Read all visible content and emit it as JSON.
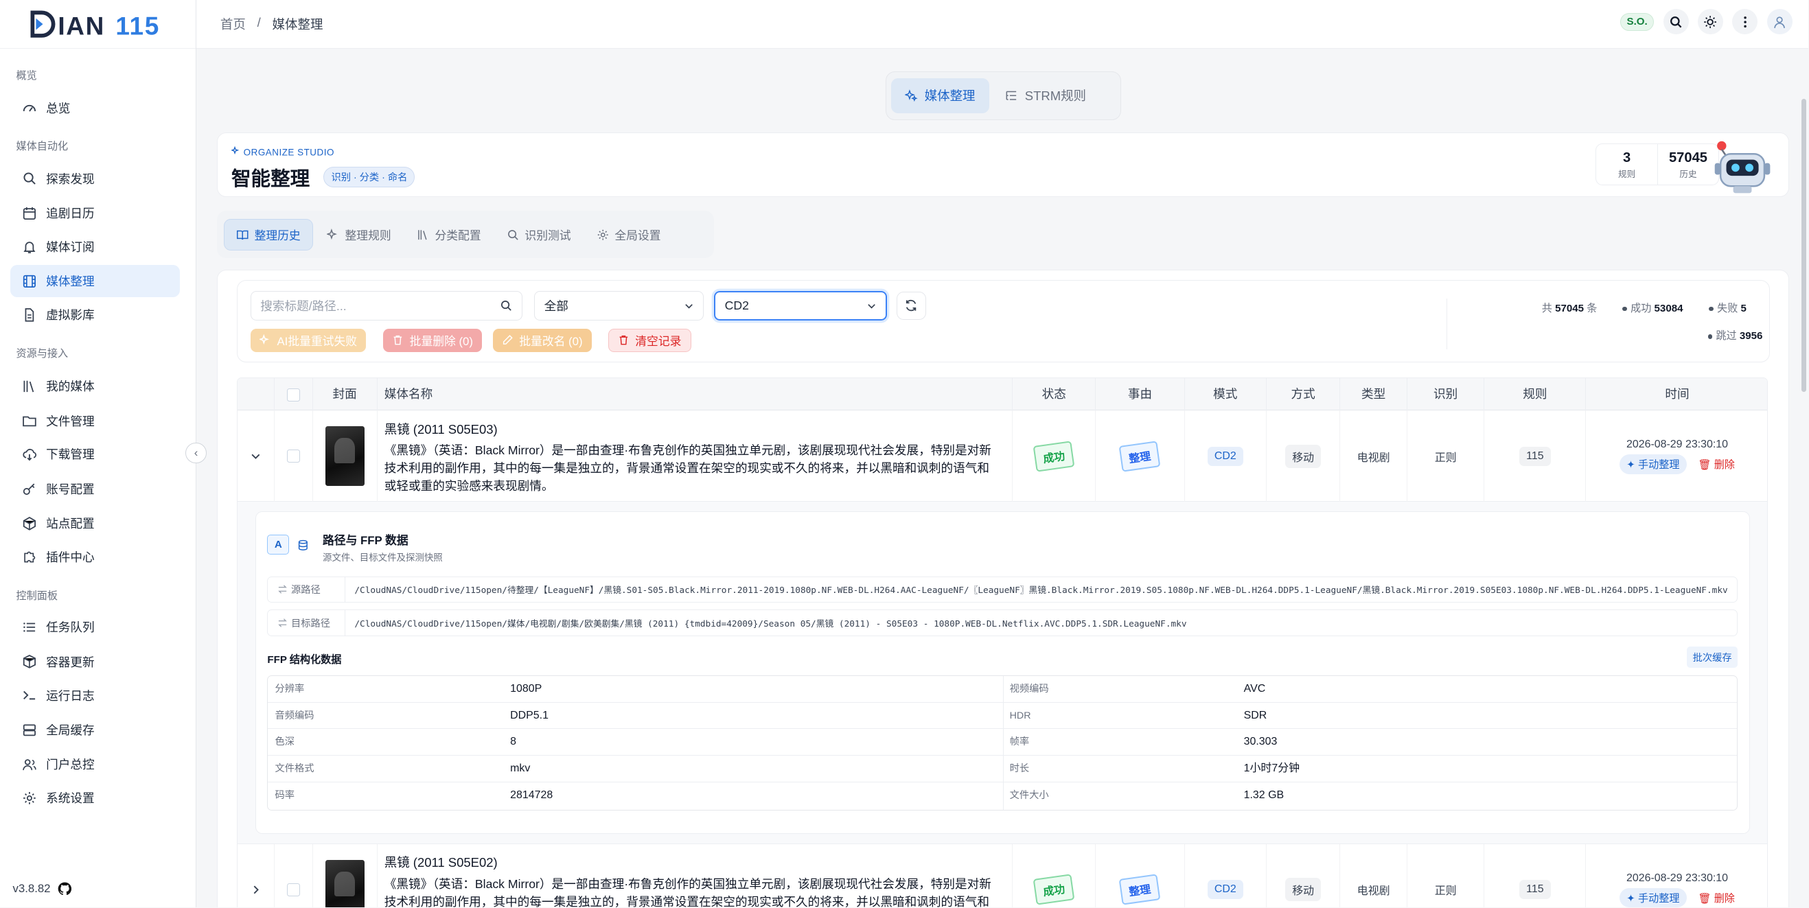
{
  "app": {
    "logo_text": "DIAN115",
    "version": "v3.8.82"
  },
  "sidebar": {
    "groups": [
      {
        "label": "概览",
        "items": [
          {
            "label": "总览",
            "icon": "gauge-icon"
          }
        ]
      },
      {
        "label": "媒体自动化",
        "items": [
          {
            "label": "探索发现",
            "icon": "search-icon"
          },
          {
            "label": "追剧日历",
            "icon": "calendar-icon"
          },
          {
            "label": "媒体订阅",
            "icon": "bell-icon"
          },
          {
            "label": "媒体整理",
            "icon": "film-icon",
            "active": true
          },
          {
            "label": "虚拟影库",
            "icon": "file-icon"
          }
        ]
      },
      {
        "label": "资源与接入",
        "items": [
          {
            "label": "我的媒体",
            "icon": "library-icon"
          },
          {
            "label": "文件管理",
            "icon": "folder-icon"
          },
          {
            "label": "下载管理",
            "icon": "cloud-download-icon"
          },
          {
            "label": "账号配置",
            "icon": "key-icon"
          },
          {
            "label": "站点配置",
            "icon": "site-icon"
          },
          {
            "label": "插件中心",
            "icon": "puzzle-icon"
          }
        ]
      },
      {
        "label": "控制面板",
        "items": [
          {
            "label": "任务队列",
            "icon": "list-icon"
          },
          {
            "label": "容器更新",
            "icon": "box-icon"
          },
          {
            "label": "运行日志",
            "icon": "terminal-icon"
          },
          {
            "label": "全局缓存",
            "icon": "database-icon"
          },
          {
            "label": "门户总控",
            "icon": "users-icon"
          },
          {
            "label": "系统设置",
            "icon": "gear-icon"
          }
        ]
      }
    ]
  },
  "breadcrumb": {
    "home": "首页",
    "sep": "/",
    "current": "媒体整理"
  },
  "topbar": {
    "badge": "S.O."
  },
  "mode_switch": {
    "organize": "媒体整理",
    "strm": "STRM规则"
  },
  "studio": {
    "kicker": "ORGANIZE STUDIO",
    "title": "智能整理",
    "tag": "识别 · 分类 · 命名",
    "rules_count": "3",
    "rules_label": "规则",
    "history_count": "57045",
    "history_label": "历史"
  },
  "subtabs": [
    "整理历史",
    "整理规则",
    "分类配置",
    "识别测试",
    "全局设置"
  ],
  "filters": {
    "search_placeholder": "搜索标题/路径...",
    "status_value": "全部",
    "mode_value": "CD2",
    "actions": {
      "retry": "AI批量重试失败",
      "delete": "批量删除 (0)",
      "rename": "批量改名 (0)",
      "clear": "清空记录"
    }
  },
  "summary": {
    "total_prefix": "共",
    "total": "57045",
    "total_suffix": "条",
    "success_label": "成功",
    "success": "53084",
    "fail_label": "失败",
    "fail": "5",
    "skip_label": "跳过",
    "skip": "3956"
  },
  "table": {
    "headers": {
      "cover": "封面",
      "name": "媒体名称",
      "status": "状态",
      "reason": "事由",
      "mode": "模式",
      "method": "方式",
      "type": "类型",
      "recog": "识别",
      "rule": "规则",
      "time": "时间"
    },
    "rows": [
      {
        "title": "黑镜 (2011 S05E03)",
        "desc": "《黑镜》（英语：Black Mirror）是一部由查理·布鲁克创作的英国独立单元剧，该剧展现现代社会发展，特别是对新技术利用的副作用，其中的每一集是独立的，背景通常设置在架空的现实或不久的将来，并以黑暗和讽刺的语气和或轻或重的实验感来表现剧情。",
        "status": "成功",
        "reason": "整理",
        "mode": "CD2",
        "method": "移动",
        "type": "电视剧",
        "recog": "正则",
        "rule": "115",
        "time": "2026-08-29 23:30:10",
        "manual": "手动整理",
        "delete": "删除"
      },
      {
        "title": "黑镜 (2011 S05E02)",
        "desc": "《黑镜》（英语：Black Mirror）是一部由查理·布鲁克创作的英国独立单元剧，该剧展现现代社会发展，特别是对新技术利用的副作用，其中的每一集是独立的，背景通常设置在架空的现实或不久的将来，并以黑暗和讽刺的语气和或",
        "status": "成功",
        "reason": "整理",
        "mode": "CD2",
        "method": "移动",
        "type": "电视剧",
        "recog": "正则",
        "rule": "115",
        "time": "2026-08-29 23:30:10",
        "manual": "手动整理",
        "delete": "删除"
      }
    ]
  },
  "detail": {
    "badge": "A",
    "title": "路径与 FFP 数据",
    "subtitle": "源文件、目标文件及探测快照",
    "source_label": "源路径",
    "source": "/CloudNAS/CloudDrive/115open/待整理/【LeagueNF】/黑镜.S01-S05.Black.Mirror.2011-2019.1080p.NF.WEB-DL.H264.AAC-LeagueNF/〖LeagueNF〗黑镜.Black.Mirror.2019.S05.1080p.NF.WEB-DL.H264.DDP5.1-LeagueNF/黑镜.Black.Mirror.2019.S05E03.1080p.NF.WEB-DL.H264.DDP5.1-LeagueNF.mkv",
    "target_label": "目标路径",
    "target": "/CloudNAS/CloudDrive/115open/媒体/电视剧/剧集/欧美剧集/黑镜 (2011) {tmdbid=42009}/Season 05/黑镜 (2011) - S05E03 - 1080P.WEB-DL.Netflix.AVC.DDP5.1.SDR.LeagueNF.mkv",
    "ffp_title": "FFP 结构化数据",
    "batch_cache": "批次缓存",
    "ffp": [
      {
        "k1": "分辨率",
        "v1": "1080P",
        "k2": "视频编码",
        "v2": "AVC"
      },
      {
        "k1": "音频编码",
        "v1": "DDP5.1",
        "k2": "HDR",
        "v2": "SDR"
      },
      {
        "k1": "色深",
        "v1": "8",
        "k2": "帧率",
        "v2": "30.303"
      },
      {
        "k1": "文件格式",
        "v1": "mkv",
        "k2": "时长",
        "v2": "1小时7分钟"
      },
      {
        "k1": "码率",
        "v1": "2814728",
        "k2": "文件大小",
        "v2": "1.32 GB"
      }
    ]
  },
  "colors": {
    "accent": "#1d64c8",
    "success": "#16a34a",
    "danger": "#dc2626"
  }
}
